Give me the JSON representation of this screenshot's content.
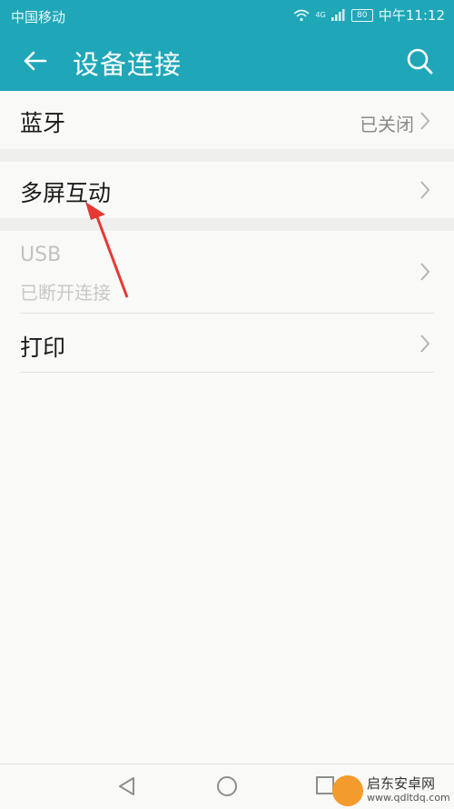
{
  "status": {
    "carrier": "中国移动",
    "signal_text": "4G",
    "battery": "80",
    "time": "中午11:12"
  },
  "appbar": {
    "title": "设备连接"
  },
  "rows": {
    "bluetooth": {
      "label": "蓝牙",
      "value": "已关闭"
    },
    "multiscreen": {
      "label": "多屏互动"
    },
    "usb": {
      "label": "USB",
      "sub": "已断开连接"
    },
    "print": {
      "label": "打印"
    }
  },
  "watermark": {
    "line1": "启东安卓网",
    "line2": "www.qdltdq.com"
  },
  "colors": {
    "accent": "#1fa7b8",
    "arrow": "#e53935"
  }
}
